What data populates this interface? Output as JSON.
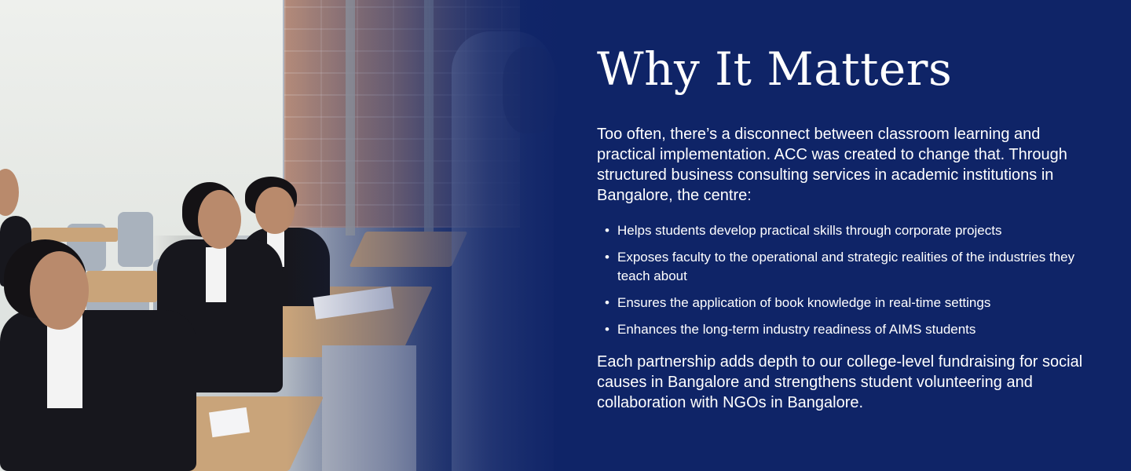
{
  "section": {
    "title": "Why It Matters",
    "intro": "Too often, there’s a disconnect between classroom learning and practical implementation. ACC was created to change that. Through structured business consulting services in academic institutions in Bangalore, the centre:",
    "bullets": [
      "Helps students develop practical skills through corporate projects",
      "Exposes faculty to the operational and strategic realities of the industries they teach about",
      "Ensures the application of book knowledge in real-time settings",
      "Enhances the long-term industry readiness of AIMS students"
    ],
    "closing": "Each partnership adds depth to our college-level fundraising for social causes in Bangalore and strengthens student volunteering and collaboration with NGOs in Bangalore."
  },
  "colors": {
    "background": "#0f2467",
    "text": "#ffffff"
  },
  "bullet_icon": "bullet-dot-icon"
}
